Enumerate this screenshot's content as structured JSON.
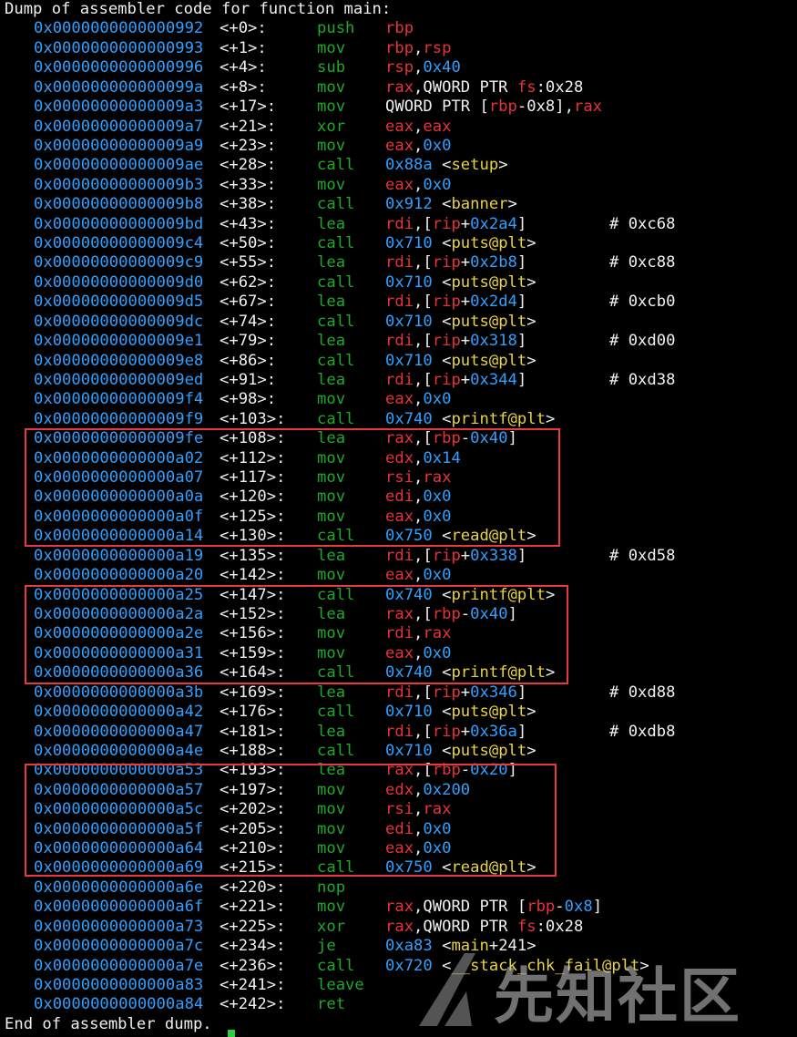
{
  "header": "Dump of assembler code for function main:",
  "footer": "End of assembler dump.",
  "watermark": "先知社区",
  "colors": {
    "address": "#2fa0ff",
    "register": "#e8323a",
    "mnemonic": "#1fa82a",
    "symbol": "#e8d43c",
    "highlight": "#e8393f"
  },
  "rows": [
    {
      "addr": "0x0000000000000992",
      "off": "<+0>:",
      "mn": "push",
      "ops": [
        [
          "rbp",
          "red"
        ]
      ],
      "cmt": ""
    },
    {
      "addr": "0x0000000000000993",
      "off": "<+1>:",
      "mn": "mov",
      "ops": [
        [
          "rbp",
          "red"
        ],
        [
          ",",
          "w"
        ],
        [
          "rsp",
          "red"
        ]
      ],
      "cmt": ""
    },
    {
      "addr": "0x0000000000000996",
      "off": "<+4>:",
      "mn": "sub",
      "ops": [
        [
          "rsp",
          "red"
        ],
        [
          ",",
          "w"
        ],
        [
          "0x40",
          "blue"
        ]
      ],
      "cmt": ""
    },
    {
      "addr": "0x000000000000099a",
      "off": "<+8>:",
      "mn": "mov",
      "ops": [
        [
          "rax",
          "red"
        ],
        [
          ",QWORD PTR ",
          "w"
        ],
        [
          "fs",
          "red"
        ],
        [
          ":0x28",
          "w"
        ]
      ],
      "cmt": ""
    },
    {
      "addr": "0x00000000000009a3",
      "off": "<+17>:",
      "mn": "mov",
      "ops": [
        [
          "QWORD PTR [",
          "w"
        ],
        [
          "rbp",
          "red"
        ],
        [
          "-0x8],",
          "w"
        ],
        [
          "rax",
          "red"
        ]
      ],
      "cmt": ""
    },
    {
      "addr": "0x00000000000009a7",
      "off": "<+21>:",
      "mn": "xor",
      "ops": [
        [
          "eax",
          "red"
        ],
        [
          ",",
          "w"
        ],
        [
          "eax",
          "red"
        ]
      ],
      "cmt": ""
    },
    {
      "addr": "0x00000000000009a9",
      "off": "<+23>:",
      "mn": "mov",
      "ops": [
        [
          "eax",
          "red"
        ],
        [
          ",",
          "w"
        ],
        [
          "0x0",
          "blue"
        ]
      ],
      "cmt": ""
    },
    {
      "addr": "0x00000000000009ae",
      "off": "<+28>:",
      "mn": "call",
      "ops": [
        [
          "0x88a",
          "blue"
        ],
        [
          " <",
          "w"
        ],
        [
          "setup",
          "yel"
        ],
        [
          ">",
          "w"
        ]
      ],
      "cmt": ""
    },
    {
      "addr": "0x00000000000009b3",
      "off": "<+33>:",
      "mn": "mov",
      "ops": [
        [
          "eax",
          "red"
        ],
        [
          ",",
          "w"
        ],
        [
          "0x0",
          "blue"
        ]
      ],
      "cmt": ""
    },
    {
      "addr": "0x00000000000009b8",
      "off": "<+38>:",
      "mn": "call",
      "ops": [
        [
          "0x912",
          "blue"
        ],
        [
          " <",
          "w"
        ],
        [
          "banner",
          "yel"
        ],
        [
          ">",
          "w"
        ]
      ],
      "cmt": ""
    },
    {
      "addr": "0x00000000000009bd",
      "off": "<+43>:",
      "mn": "lea",
      "ops": [
        [
          "rdi",
          "red"
        ],
        [
          ",[",
          "w"
        ],
        [
          "rip",
          "red"
        ],
        [
          "+",
          "w"
        ],
        [
          "0x2a4",
          "blue"
        ],
        [
          "]",
          "w"
        ]
      ],
      "cmt": "# 0xc68"
    },
    {
      "addr": "0x00000000000009c4",
      "off": "<+50>:",
      "mn": "call",
      "ops": [
        [
          "0x710",
          "blue"
        ],
        [
          " <",
          "w"
        ],
        [
          "puts@plt",
          "yel"
        ],
        [
          ">",
          "w"
        ]
      ],
      "cmt": ""
    },
    {
      "addr": "0x00000000000009c9",
      "off": "<+55>:",
      "mn": "lea",
      "ops": [
        [
          "rdi",
          "red"
        ],
        [
          ",[",
          "w"
        ],
        [
          "rip",
          "red"
        ],
        [
          "+",
          "w"
        ],
        [
          "0x2b8",
          "blue"
        ],
        [
          "]",
          "w"
        ]
      ],
      "cmt": "# 0xc88"
    },
    {
      "addr": "0x00000000000009d0",
      "off": "<+62>:",
      "mn": "call",
      "ops": [
        [
          "0x710",
          "blue"
        ],
        [
          " <",
          "w"
        ],
        [
          "puts@plt",
          "yel"
        ],
        [
          ">",
          "w"
        ]
      ],
      "cmt": ""
    },
    {
      "addr": "0x00000000000009d5",
      "off": "<+67>:",
      "mn": "lea",
      "ops": [
        [
          "rdi",
          "red"
        ],
        [
          ",[",
          "w"
        ],
        [
          "rip",
          "red"
        ],
        [
          "+",
          "w"
        ],
        [
          "0x2d4",
          "blue"
        ],
        [
          "]",
          "w"
        ]
      ],
      "cmt": "# 0xcb0"
    },
    {
      "addr": "0x00000000000009dc",
      "off": "<+74>:",
      "mn": "call",
      "ops": [
        [
          "0x710",
          "blue"
        ],
        [
          " <",
          "w"
        ],
        [
          "puts@plt",
          "yel"
        ],
        [
          ">",
          "w"
        ]
      ],
      "cmt": ""
    },
    {
      "addr": "0x00000000000009e1",
      "off": "<+79>:",
      "mn": "lea",
      "ops": [
        [
          "rdi",
          "red"
        ],
        [
          ",[",
          "w"
        ],
        [
          "rip",
          "red"
        ],
        [
          "+",
          "w"
        ],
        [
          "0x318",
          "blue"
        ],
        [
          "]",
          "w"
        ]
      ],
      "cmt": "# 0xd00"
    },
    {
      "addr": "0x00000000000009e8",
      "off": "<+86>:",
      "mn": "call",
      "ops": [
        [
          "0x710",
          "blue"
        ],
        [
          " <",
          "w"
        ],
        [
          "puts@plt",
          "yel"
        ],
        [
          ">",
          "w"
        ]
      ],
      "cmt": ""
    },
    {
      "addr": "0x00000000000009ed",
      "off": "<+91>:",
      "mn": "lea",
      "ops": [
        [
          "rdi",
          "red"
        ],
        [
          ",[",
          "w"
        ],
        [
          "rip",
          "red"
        ],
        [
          "+",
          "w"
        ],
        [
          "0x344",
          "blue"
        ],
        [
          "]",
          "w"
        ]
      ],
      "cmt": "# 0xd38"
    },
    {
      "addr": "0x00000000000009f4",
      "off": "<+98>:",
      "mn": "mov",
      "ops": [
        [
          "eax",
          "red"
        ],
        [
          ",",
          "w"
        ],
        [
          "0x0",
          "blue"
        ]
      ],
      "cmt": ""
    },
    {
      "addr": "0x00000000000009f9",
      "off": "<+103>:",
      "mn": "call",
      "ops": [
        [
          "0x740",
          "blue"
        ],
        [
          " <",
          "w"
        ],
        [
          "printf@plt",
          "yel"
        ],
        [
          ">",
          "w"
        ]
      ],
      "cmt": ""
    },
    {
      "addr": "0x00000000000009fe",
      "off": "<+108>:",
      "mn": "lea",
      "ops": [
        [
          "rax",
          "red"
        ],
        [
          ",[",
          "w"
        ],
        [
          "rbp",
          "red"
        ],
        [
          "-",
          "w"
        ],
        [
          "0x40",
          "blue"
        ],
        [
          "]",
          "w"
        ]
      ],
      "cmt": ""
    },
    {
      "addr": "0x0000000000000a02",
      "off": "<+112>:",
      "mn": "mov",
      "ops": [
        [
          "edx",
          "red"
        ],
        [
          ",",
          "w"
        ],
        [
          "0x14",
          "blue"
        ]
      ],
      "cmt": ""
    },
    {
      "addr": "0x0000000000000a07",
      "off": "<+117>:",
      "mn": "mov",
      "ops": [
        [
          "rsi",
          "red"
        ],
        [
          ",",
          "w"
        ],
        [
          "rax",
          "red"
        ]
      ],
      "cmt": ""
    },
    {
      "addr": "0x0000000000000a0a",
      "off": "<+120>:",
      "mn": "mov",
      "ops": [
        [
          "edi",
          "red"
        ],
        [
          ",",
          "w"
        ],
        [
          "0x0",
          "blue"
        ]
      ],
      "cmt": ""
    },
    {
      "addr": "0x0000000000000a0f",
      "off": "<+125>:",
      "mn": "mov",
      "ops": [
        [
          "eax",
          "red"
        ],
        [
          ",",
          "w"
        ],
        [
          "0x0",
          "blue"
        ]
      ],
      "cmt": ""
    },
    {
      "addr": "0x0000000000000a14",
      "off": "<+130>:",
      "mn": "call",
      "ops": [
        [
          "0x750",
          "blue"
        ],
        [
          " <",
          "w"
        ],
        [
          "read@plt",
          "yel"
        ],
        [
          ">",
          "w"
        ]
      ],
      "cmt": ""
    },
    {
      "addr": "0x0000000000000a19",
      "off": "<+135>:",
      "mn": "lea",
      "ops": [
        [
          "rdi",
          "red"
        ],
        [
          ",[",
          "w"
        ],
        [
          "rip",
          "red"
        ],
        [
          "+",
          "w"
        ],
        [
          "0x338",
          "blue"
        ],
        [
          "]",
          "w"
        ]
      ],
      "cmt": "# 0xd58"
    },
    {
      "addr": "0x0000000000000a20",
      "off": "<+142>:",
      "mn": "mov",
      "ops": [
        [
          "eax",
          "red"
        ],
        [
          ",",
          "w"
        ],
        [
          "0x0",
          "blue"
        ]
      ],
      "cmt": ""
    },
    {
      "addr": "0x0000000000000a25",
      "off": "<+147>:",
      "mn": "call",
      "ops": [
        [
          "0x740",
          "blue"
        ],
        [
          " <",
          "w"
        ],
        [
          "printf@plt",
          "yel"
        ],
        [
          ">",
          "w"
        ]
      ],
      "cmt": ""
    },
    {
      "addr": "0x0000000000000a2a",
      "off": "<+152>:",
      "mn": "lea",
      "ops": [
        [
          "rax",
          "red"
        ],
        [
          ",[",
          "w"
        ],
        [
          "rbp",
          "red"
        ],
        [
          "-",
          "w"
        ],
        [
          "0x40",
          "blue"
        ],
        [
          "]",
          "w"
        ]
      ],
      "cmt": ""
    },
    {
      "addr": "0x0000000000000a2e",
      "off": "<+156>:",
      "mn": "mov",
      "ops": [
        [
          "rdi",
          "red"
        ],
        [
          ",",
          "w"
        ],
        [
          "rax",
          "red"
        ]
      ],
      "cmt": ""
    },
    {
      "addr": "0x0000000000000a31",
      "off": "<+159>:",
      "mn": "mov",
      "ops": [
        [
          "eax",
          "red"
        ],
        [
          ",",
          "w"
        ],
        [
          "0x0",
          "blue"
        ]
      ],
      "cmt": ""
    },
    {
      "addr": "0x0000000000000a36",
      "off": "<+164>:",
      "mn": "call",
      "ops": [
        [
          "0x740",
          "blue"
        ],
        [
          " <",
          "w"
        ],
        [
          "printf@plt",
          "yel"
        ],
        [
          ">",
          "w"
        ]
      ],
      "cmt": ""
    },
    {
      "addr": "0x0000000000000a3b",
      "off": "<+169>:",
      "mn": "lea",
      "ops": [
        [
          "rdi",
          "red"
        ],
        [
          ",[",
          "w"
        ],
        [
          "rip",
          "red"
        ],
        [
          "+",
          "w"
        ],
        [
          "0x346",
          "blue"
        ],
        [
          "]",
          "w"
        ]
      ],
      "cmt": "# 0xd88"
    },
    {
      "addr": "0x0000000000000a42",
      "off": "<+176>:",
      "mn": "call",
      "ops": [
        [
          "0x710",
          "blue"
        ],
        [
          " <",
          "w"
        ],
        [
          "puts@plt",
          "yel"
        ],
        [
          ">",
          "w"
        ]
      ],
      "cmt": ""
    },
    {
      "addr": "0x0000000000000a47",
      "off": "<+181>:",
      "mn": "lea",
      "ops": [
        [
          "rdi",
          "red"
        ],
        [
          ",[",
          "w"
        ],
        [
          "rip",
          "red"
        ],
        [
          "+",
          "w"
        ],
        [
          "0x36a",
          "blue"
        ],
        [
          "]",
          "w"
        ]
      ],
      "cmt": "# 0xdb8"
    },
    {
      "addr": "0x0000000000000a4e",
      "off": "<+188>:",
      "mn": "call",
      "ops": [
        [
          "0x710",
          "blue"
        ],
        [
          " <",
          "w"
        ],
        [
          "puts@plt",
          "yel"
        ],
        [
          ">",
          "w"
        ]
      ],
      "cmt": ""
    },
    {
      "addr": "0x0000000000000a53",
      "off": "<+193>:",
      "mn": "lea",
      "ops": [
        [
          "rax",
          "red"
        ],
        [
          ",[",
          "w"
        ],
        [
          "rbp",
          "red"
        ],
        [
          "-",
          "w"
        ],
        [
          "0x20",
          "blue"
        ],
        [
          "]",
          "w"
        ]
      ],
      "cmt": ""
    },
    {
      "addr": "0x0000000000000a57",
      "off": "<+197>:",
      "mn": "mov",
      "ops": [
        [
          "edx",
          "red"
        ],
        [
          ",",
          "w"
        ],
        [
          "0x200",
          "blue"
        ]
      ],
      "cmt": ""
    },
    {
      "addr": "0x0000000000000a5c",
      "off": "<+202>:",
      "mn": "mov",
      "ops": [
        [
          "rsi",
          "red"
        ],
        [
          ",",
          "w"
        ],
        [
          "rax",
          "red"
        ]
      ],
      "cmt": ""
    },
    {
      "addr": "0x0000000000000a5f",
      "off": "<+205>:",
      "mn": "mov",
      "ops": [
        [
          "edi",
          "red"
        ],
        [
          ",",
          "w"
        ],
        [
          "0x0",
          "blue"
        ]
      ],
      "cmt": ""
    },
    {
      "addr": "0x0000000000000a64",
      "off": "<+210>:",
      "mn": "mov",
      "ops": [
        [
          "eax",
          "red"
        ],
        [
          ",",
          "w"
        ],
        [
          "0x0",
          "blue"
        ]
      ],
      "cmt": ""
    },
    {
      "addr": "0x0000000000000a69",
      "off": "<+215>:",
      "mn": "call",
      "ops": [
        [
          "0x750",
          "blue"
        ],
        [
          " <",
          "w"
        ],
        [
          "read@plt",
          "yel"
        ],
        [
          ">",
          "w"
        ]
      ],
      "cmt": ""
    },
    {
      "addr": "0x0000000000000a6e",
      "off": "<+220>:",
      "mn": "nop",
      "ops": [],
      "cmt": ""
    },
    {
      "addr": "0x0000000000000a6f",
      "off": "<+221>:",
      "mn": "mov",
      "ops": [
        [
          "rax",
          "red"
        ],
        [
          ",QWORD PTR [",
          "w"
        ],
        [
          "rbp",
          "red"
        ],
        [
          "-",
          "w"
        ],
        [
          "0x8",
          "blue"
        ],
        [
          "]",
          "w"
        ]
      ],
      "cmt": ""
    },
    {
      "addr": "0x0000000000000a73",
      "off": "<+225>:",
      "mn": "xor",
      "ops": [
        [
          "rax",
          "red"
        ],
        [
          ",QWORD PTR ",
          "w"
        ],
        [
          "fs",
          "red"
        ],
        [
          ":0x28",
          "w"
        ]
      ],
      "cmt": ""
    },
    {
      "addr": "0x0000000000000a7c",
      "off": "<+234>:",
      "mn": "je",
      "ops": [
        [
          "0xa83",
          "blue"
        ],
        [
          " <",
          "w"
        ],
        [
          "main",
          "yel"
        ],
        [
          "+241>",
          "w"
        ]
      ],
      "cmt": ""
    },
    {
      "addr": "0x0000000000000a7e",
      "off": "<+236>:",
      "mn": "call",
      "ops": [
        [
          "0x720",
          "blue"
        ],
        [
          " <",
          "w"
        ],
        [
          "__stack_chk_fail@plt",
          "yel"
        ],
        [
          ">",
          "w"
        ]
      ],
      "cmt": ""
    },
    {
      "addr": "0x0000000000000a83",
      "off": "<+241>:",
      "mn": "leave",
      "ops": [],
      "cmt": ""
    },
    {
      "addr": "0x0000000000000a84",
      "off": "<+242>:",
      "mn": "ret",
      "ops": [],
      "cmt": ""
    }
  ]
}
